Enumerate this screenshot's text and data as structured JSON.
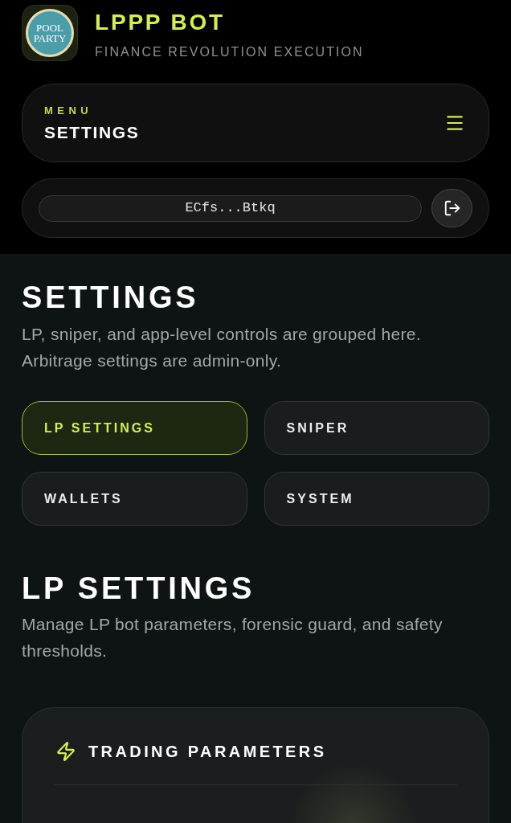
{
  "header": {
    "logo": {
      "lines": [
        "POOL",
        "PARTY"
      ]
    },
    "title": "LPPP BOT",
    "subtitle": "FINANCE REVOLUTION EXECUTION"
  },
  "menu": {
    "label": "MENU",
    "current": "SETTINGS"
  },
  "wallet": {
    "address": "ECfs...Btkq"
  },
  "page": {
    "title": "SETTINGS",
    "description": "LP, sniper, and app-level controls are grouped here. Arbitrage settings are admin-only."
  },
  "tabs": [
    {
      "label": "LP SETTINGS",
      "selected": true
    },
    {
      "label": "SNIPER",
      "selected": false
    },
    {
      "label": "WALLETS",
      "selected": false
    },
    {
      "label": "SYSTEM",
      "selected": false
    }
  ],
  "section": {
    "title": "LP SETTINGS",
    "description": "Manage LP bot parameters, forensic guard, and safety thresholds."
  },
  "card": {
    "title": "TRADING PARAMETERS"
  }
}
